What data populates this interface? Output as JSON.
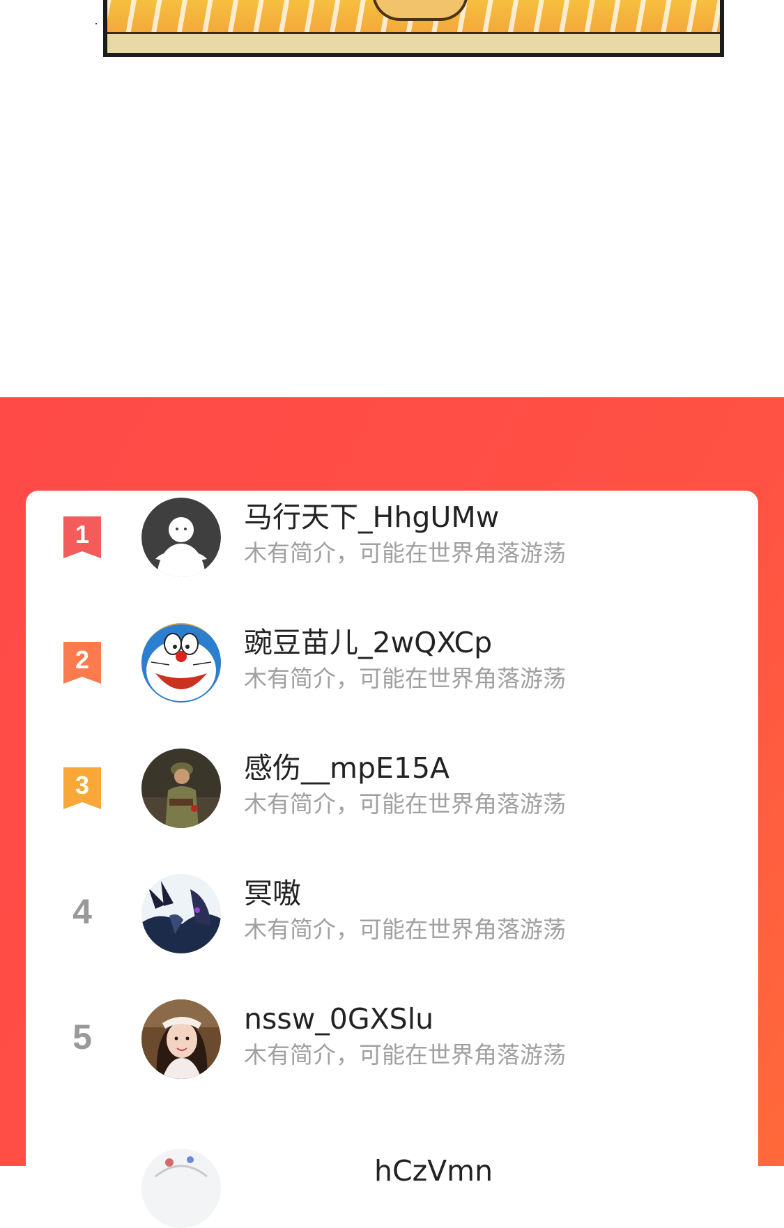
{
  "colors": {
    "section_bg": "#ff4a48",
    "card_bg": "#ffffff",
    "badge_1": "#f45b5b",
    "badge_2": "#fb7a4e",
    "badge_3": "#f9a736",
    "rank_plain": "#999999",
    "name": "#222222",
    "bio": "#a0a0a0"
  },
  "ranking": {
    "items": [
      {
        "rank": "1",
        "name": "马行天下_HhgUMw",
        "bio": "木有简介，可能在世界角落游荡",
        "avatar": "default-person-icon"
      },
      {
        "rank": "2",
        "name": "豌豆苗儿_2wQXCp",
        "bio": "木有简介，可能在世界角落游荡",
        "avatar": "doraemon-avatar"
      },
      {
        "rank": "3",
        "name": "感伤__mpE15A",
        "bio": "木有简介，可能在世界角落游荡",
        "avatar": "soldier-photo-avatar"
      },
      {
        "rank": "4",
        "name": "冥嗷",
        "bio": "木有简介，可能在世界角落游荡",
        "avatar": "dragon-art-avatar"
      },
      {
        "rank": "5",
        "name": "nssw_0GXSlu",
        "bio": "木有简介，可能在世界角落游荡",
        "avatar": "girl-photo-avatar"
      },
      {
        "rank": "",
        "name": "hCzVmn",
        "bio": "",
        "avatar": "partial-avatar"
      }
    ]
  }
}
